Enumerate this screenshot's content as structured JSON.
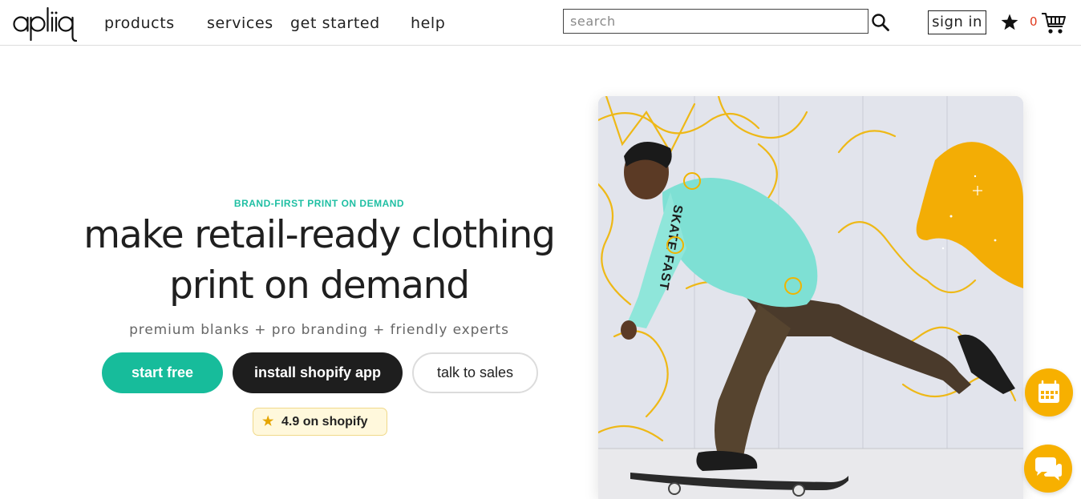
{
  "header": {
    "logo_text": "apliiq",
    "nav": [
      {
        "label": "products"
      },
      {
        "label": "services"
      },
      {
        "label": "get started"
      },
      {
        "label": "help"
      }
    ],
    "search": {
      "placeholder": "search",
      "value": ""
    },
    "sign_in_label": "sign in",
    "cart_count": "0",
    "icons": {
      "search": "search-icon",
      "favorites": "star-icon",
      "cart": "cart-icon"
    },
    "cart_count_color": "#e03a1e"
  },
  "hero": {
    "eyebrow": "BRAND-FIRST PRINT ON DEMAND",
    "headline_line1": "make retail-ready clothing",
    "headline_line2": "print on demand",
    "subhead": "premium blanks + pro branding + friendly experts",
    "buttons": {
      "start_free": "start free",
      "install_shopify": "install shopify app",
      "talk_to_sales": "talk to sales"
    },
    "rating": {
      "text": "4.9 on shopify",
      "icon": "star-icon"
    },
    "image": {
      "alt": "skateboarder wearing a mint SKATE FAST sweatshirt"
    }
  },
  "floating": {
    "calendar_icon": "calendar-icon",
    "chat_icon": "chat-icon"
  },
  "colors": {
    "accent_teal": "#17bc9b",
    "dark_button": "#1e1e1e",
    "floating_yellow": "#f7b000",
    "badge_bg": "#fff8dc"
  }
}
